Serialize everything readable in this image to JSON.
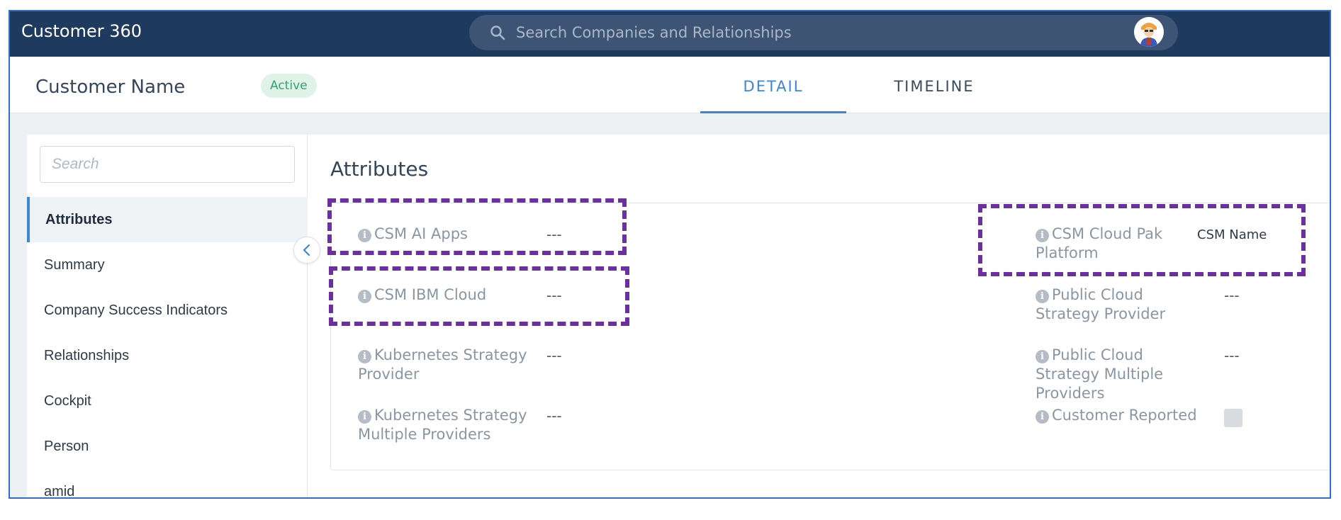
{
  "app": {
    "title": "Customer 360"
  },
  "search": {
    "placeholder": "Search Companies and Relationships"
  },
  "header": {
    "customer_name": "Customer Name",
    "status": "Active"
  },
  "tabs": [
    {
      "label": "DETAIL",
      "active": true
    },
    {
      "label": "TIMELINE",
      "active": false
    }
  ],
  "sidebar": {
    "search_placeholder": "Search",
    "items": [
      {
        "label": "Attributes",
        "active": true
      },
      {
        "label": "Summary"
      },
      {
        "label": "Company Success Indicators"
      },
      {
        "label": "Relationships"
      },
      {
        "label": "Cockpit"
      },
      {
        "label": "Person"
      },
      {
        "label": "amid"
      }
    ]
  },
  "main": {
    "section_title": "Attributes",
    "left_attributes": [
      {
        "label": "CSM AI Apps",
        "value": "---"
      },
      {
        "label": "CSM IBM Cloud",
        "value": "---"
      },
      {
        "label": "Kubernetes Strategy Provider",
        "value": "---"
      },
      {
        "label": "Kubernetes Strategy Multiple Providers",
        "value": "---"
      }
    ],
    "right_attributes": [
      {
        "label": "CSM Cloud Pak Platform",
        "value": "CSM Name"
      },
      {
        "label": "Public Cloud Strategy Provider",
        "value": "---"
      },
      {
        "label": "Public Cloud Strategy Multiple Providers",
        "value": "---"
      },
      {
        "label": "Customer Reported",
        "value": null,
        "checked": false
      }
    ]
  },
  "colors": {
    "topbar": "#1f3a5f",
    "accent": "#3b86d8",
    "highlight": "#6b2fa0",
    "active_badge": "#32a567"
  }
}
